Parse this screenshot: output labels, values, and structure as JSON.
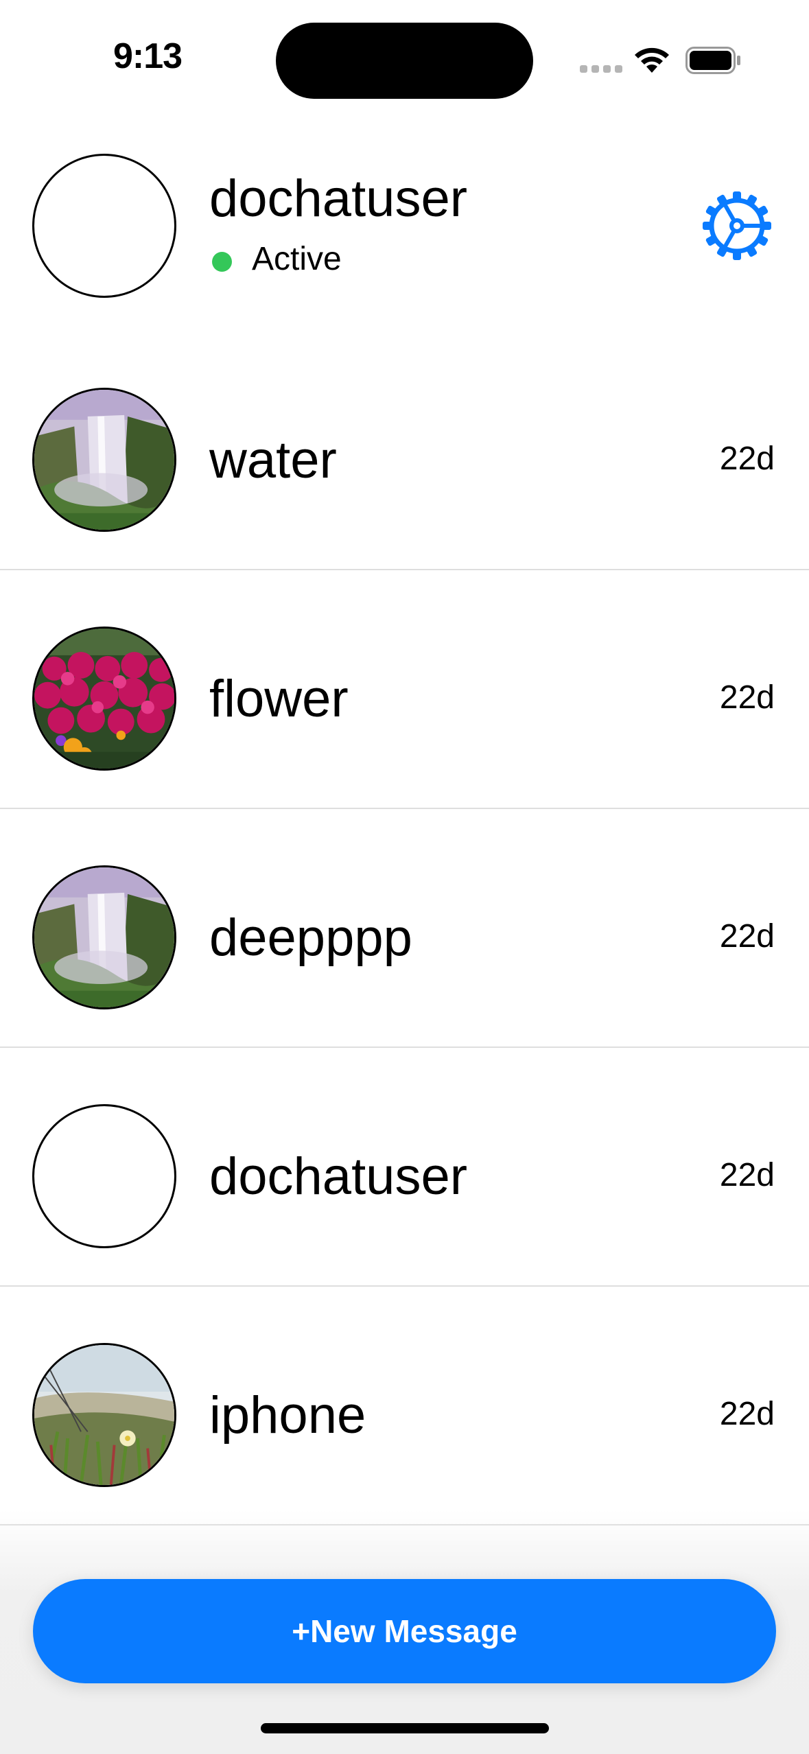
{
  "status_bar": {
    "time": "9:13",
    "wifi_icon": "wifi-icon",
    "battery_icon": "battery-icon"
  },
  "header": {
    "username": "dochatuser",
    "status": "Active",
    "status_color": "#34c759",
    "settings_icon": "gear-icon",
    "accent": "#0a7bff"
  },
  "conversations": [
    {
      "name": "water",
      "time": "22d",
      "avatar": "waterfall-photo"
    },
    {
      "name": "flower",
      "time": "22d",
      "avatar": "flowers-photo"
    },
    {
      "name": "deepppp",
      "time": "22d",
      "avatar": "waterfall-photo"
    },
    {
      "name": "dochatuser",
      "time": "22d",
      "avatar": "empty-avatar"
    },
    {
      "name": "iphone",
      "time": "22d",
      "avatar": "succulent-photo"
    }
  ],
  "new_message_button": {
    "label": "+New Message"
  }
}
